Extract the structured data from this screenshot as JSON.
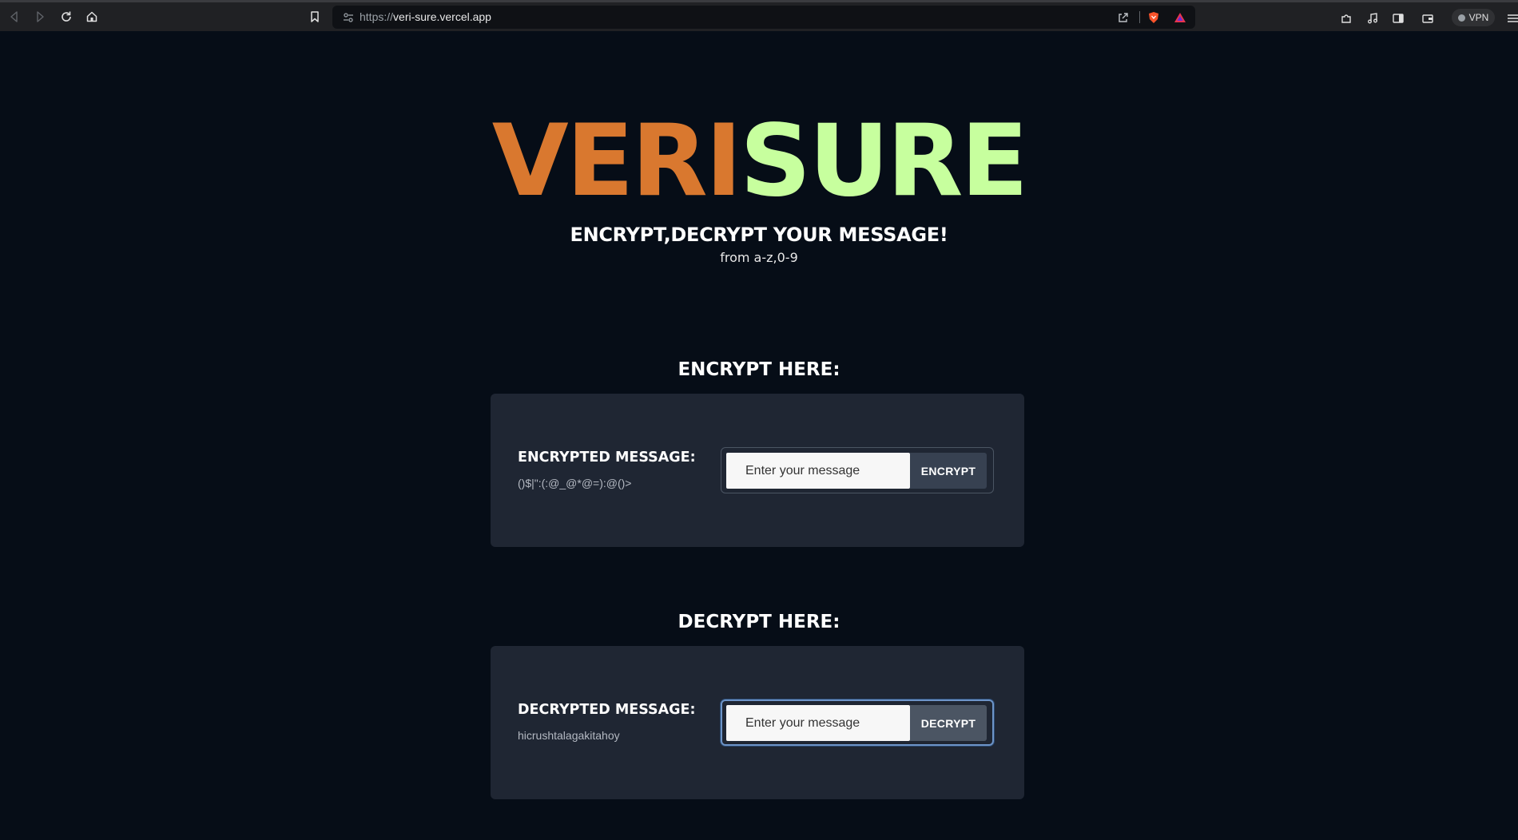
{
  "browser": {
    "url_scheme": "https://",
    "url_host": "veri-sure.vercel.app",
    "vpn_label": "VPN",
    "icons": [
      "back-icon",
      "forward-icon",
      "reload-icon",
      "home-icon",
      "bookmark-icon",
      "site-settings-icon",
      "share-icon",
      "brave-shields-icon",
      "brave-rewards-icon",
      "extensions-icon",
      "media-icon",
      "sidebar-icon",
      "wallet-icon",
      "menu-icon"
    ]
  },
  "hero": {
    "brand_part1": "VERI",
    "brand_part2": "SURE",
    "brand_color1": "#d9782f",
    "brand_color2": "#c7ff9e",
    "tagline": "ENCRYPT,DECRYPT YOUR MESSAGE!",
    "subtitle": "from a-z,0-9"
  },
  "encrypt": {
    "section_title": "ENCRYPT HERE:",
    "label": "ENCRYPTED MESSAGE:",
    "result": "()$|\":(:@_@*@=):@()>",
    "placeholder": "Enter your message",
    "button": "ENCRYPT"
  },
  "decrypt": {
    "section_title": "DECRYPT HERE:",
    "label": "DECRYPTED MESSAGE:",
    "result": "hicrushtalagakitahoy",
    "placeholder": "Enter your message",
    "button": "DECRYPT"
  },
  "colors": {
    "page_background": "#060d17",
    "card_background": "#1f2633",
    "button_background": "#374151",
    "focus_ring": "#6d94c8"
  }
}
